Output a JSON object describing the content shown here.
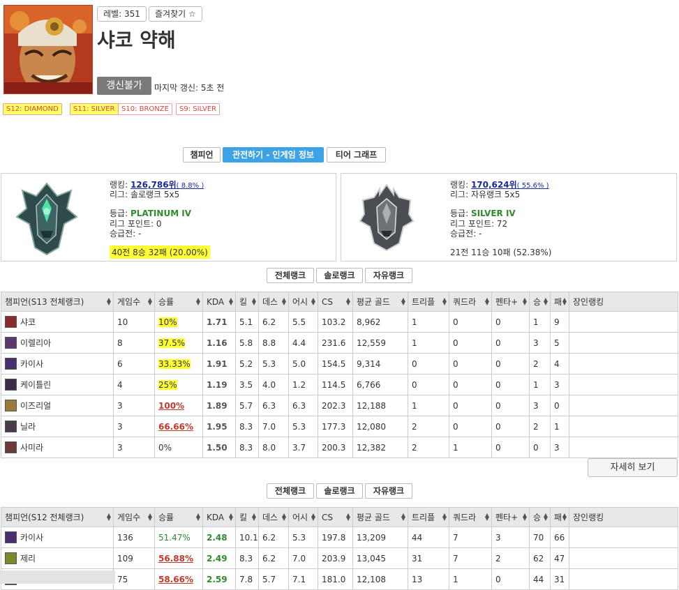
{
  "profile": {
    "name": "샤코 약해",
    "level": "레벨: 351",
    "favorite": "즐겨찾기 ☆",
    "renew": "갱신불가",
    "last_update": "마지막 갱신: 5초 전",
    "seasons": [
      {
        "label": "S12: DIAMOND",
        "highlight": true
      },
      {
        "label": "S11: SILVER",
        "highlight": true
      },
      {
        "label": "S10: BRONZE",
        "highlight": false
      },
      {
        "label": "S9: SILVER",
        "highlight": false
      }
    ]
  },
  "tabs": [
    "챔피언",
    "관전하기 - 인게임 정보",
    "티어 그래프"
  ],
  "solo": {
    "rank_label": "랭킹:",
    "rank": "126,786위",
    "rank_pct": "( 8.8% )",
    "league": "리그: 솔로랭크 5x5",
    "tier_label": "등급:",
    "tier": "PLATINUM IV",
    "lp": "리그 포인트: 0",
    "promo": "승급전: -",
    "record": "40전 8승 32패 (20.00%)"
  },
  "flex": {
    "rank_label": "랭킹:",
    "rank": "170,624위",
    "rank_pct": "( 55.6% )",
    "league": "리그: 자유랭크 5x5",
    "tier_label": "등급:",
    "tier": "SILVER IV",
    "lp": "리그 포인트: 72",
    "promo": "승급전: -",
    "record": "21전 11승 10패 (52.38%)"
  },
  "filters": [
    "전체랭크",
    "솔로랭크",
    "자유랭크"
  ],
  "s13": {
    "headers": [
      "챔피언(S13 전체랭크)",
      "게임수",
      "승률",
      "KDA",
      "킬",
      "데스",
      "어시",
      "CS",
      "평균 골드",
      "트리플",
      "쿼드라",
      "펜타+",
      "승",
      "패",
      "장인랭킹"
    ],
    "rows": [
      {
        "champ": "샤코",
        "games": "10",
        "wr": "10%",
        "kda": "1.71",
        "k": "5.1",
        "d": "6.2",
        "a": "5.5",
        "cs": "103.2",
        "gold": "8,962",
        "triple": "1",
        "quadra": "0",
        "penta": "0",
        "win": "1",
        "lose": "9",
        "icon": "#8a2b2b"
      },
      {
        "champ": "이렐리아",
        "games": "8",
        "wr": "37.5%",
        "kda": "1.16",
        "k": "5.8",
        "d": "8.8",
        "a": "4.4",
        "cs": "231.6",
        "gold": "12,559",
        "triple": "1",
        "quadra": "0",
        "penta": "0",
        "win": "3",
        "lose": "5",
        "icon": "#5a3a6a"
      },
      {
        "champ": "카이사",
        "games": "6",
        "wr": "33.33%",
        "kda": "1.91",
        "k": "5.2",
        "d": "5.3",
        "a": "5.0",
        "cs": "154.5",
        "gold": "9,314",
        "triple": "0",
        "quadra": "0",
        "penta": "0",
        "win": "2",
        "lose": "4",
        "icon": "#4a2f6e"
      },
      {
        "champ": "케이틀린",
        "games": "4",
        "wr": "25%",
        "kda": "1.19",
        "k": "3.5",
        "d": "4.0",
        "a": "1.2",
        "cs": "114.5",
        "gold": "6,766",
        "triple": "0",
        "quadra": "0",
        "penta": "0",
        "win": "1",
        "lose": "3",
        "icon": "#3b2a4a"
      },
      {
        "champ": "이즈리얼",
        "games": "3",
        "wr": "100%",
        "kda": "1.89",
        "k": "5.7",
        "d": "6.3",
        "a": "6.3",
        "cs": "202.3",
        "gold": "12,188",
        "triple": "1",
        "quadra": "0",
        "penta": "0",
        "win": "3",
        "lose": "0",
        "icon": "#9a7a3a"
      },
      {
        "champ": "닐라",
        "games": "3",
        "wr": "66.66%",
        "kda": "1.95",
        "k": "8.3",
        "d": "7.0",
        "a": "5.3",
        "cs": "177.3",
        "gold": "12,080",
        "triple": "2",
        "quadra": "0",
        "penta": "0",
        "win": "2",
        "lose": "1",
        "icon": "#4a3a4a"
      },
      {
        "champ": "사미라",
        "games": "3",
        "wr": "0%",
        "kda": "1.50",
        "k": "8.3",
        "d": "8.0",
        "a": "3.7",
        "cs": "200.3",
        "gold": "12,382",
        "triple": "2",
        "quadra": "1",
        "penta": "0",
        "win": "0",
        "lose": "3",
        "icon": "#6a3a3a"
      }
    ]
  },
  "more": "자세히 보기",
  "s12": {
    "headers": [
      "챔피언(S12 전체랭크)",
      "게임수",
      "승률",
      "KDA",
      "킬",
      "데스",
      "어시",
      "CS",
      "평균 골드",
      "트리플",
      "쿼드라",
      "펜타+",
      "승",
      "패",
      "장인랭킹"
    ],
    "rows": [
      {
        "champ": "카이사",
        "games": "136",
        "wr": "51.47%",
        "kda": "2.48",
        "k": "10.1",
        "d": "6.2",
        "a": "5.3",
        "cs": "197.8",
        "gold": "13,209",
        "triple": "44",
        "quadra": "7",
        "penta": "3",
        "win": "70",
        "lose": "66",
        "icon": "#4a2f6e"
      },
      {
        "champ": "제리",
        "games": "109",
        "wr": "56.88%",
        "kda": "2.49",
        "k": "8.3",
        "d": "6.2",
        "a": "7.0",
        "cs": "203.9",
        "gold": "13,045",
        "triple": "31",
        "quadra": "7",
        "penta": "2",
        "win": "62",
        "lose": "47",
        "icon": "#7a8a2a"
      },
      {
        "champ": "",
        "games": "75",
        "wr": "58.66%",
        "kda": "2.59",
        "k": "7.8",
        "d": "5.7",
        "a": "7.1",
        "cs": "181.0",
        "gold": "12,108",
        "triple": "13",
        "quadra": "1",
        "penta": "0",
        "win": "44",
        "lose": "31",
        "icon": "#555555"
      }
    ]
  }
}
